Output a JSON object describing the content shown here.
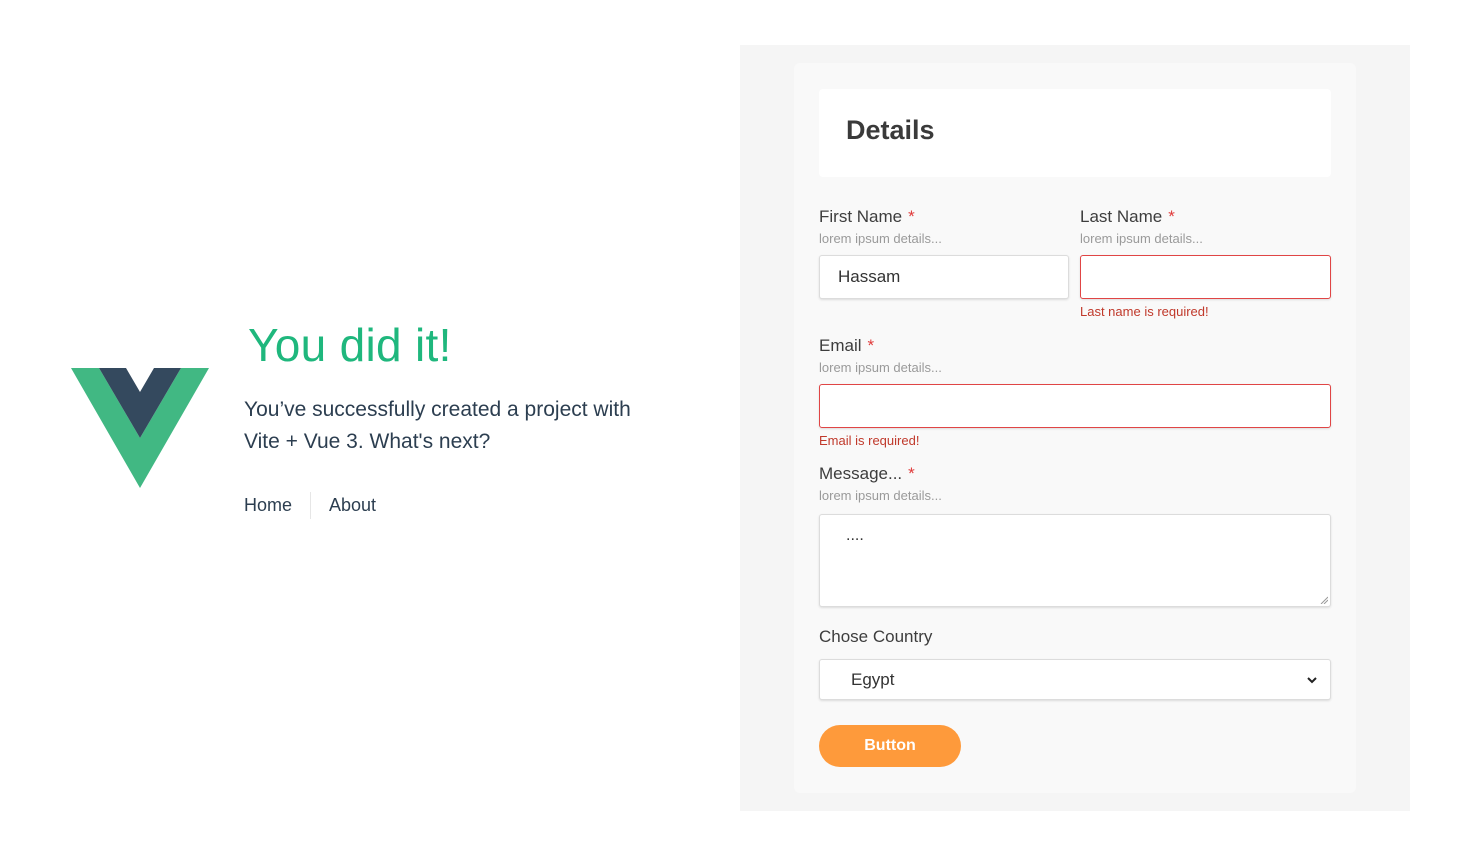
{
  "hero": {
    "title": "You did it!",
    "subtitle_part1": "You’ve successfully created a project with",
    "subtitle_vite": "Vite",
    "subtitle_plus": "+",
    "subtitle_vue": "Vue 3",
    "subtitle_part2": ". What's next?"
  },
  "nav": {
    "items": [
      "Home",
      "About"
    ]
  },
  "form": {
    "title": "Details",
    "first_name": {
      "label": "First Name",
      "required": "*",
      "help": "lorem ipsum details...",
      "value": "Hassam"
    },
    "last_name": {
      "label": "Last Name",
      "required": "*",
      "help": "lorem ipsum details...",
      "value": "",
      "error": "Last name is required!"
    },
    "email": {
      "label": "Email",
      "required": "*",
      "help": "lorem ipsum details...",
      "value": "",
      "error": "Email is required!"
    },
    "message": {
      "label": "Message...",
      "required": "*",
      "help": "lorem ipsum details...",
      "value": "...."
    },
    "country": {
      "label": "Chose Country",
      "selected": "Egypt"
    },
    "button_label": "Button"
  },
  "colors": {
    "vue_green": "#41b883",
    "vue_dark": "#34495e",
    "accent_orange": "#fe9a3b",
    "error_red": "#e04545"
  }
}
